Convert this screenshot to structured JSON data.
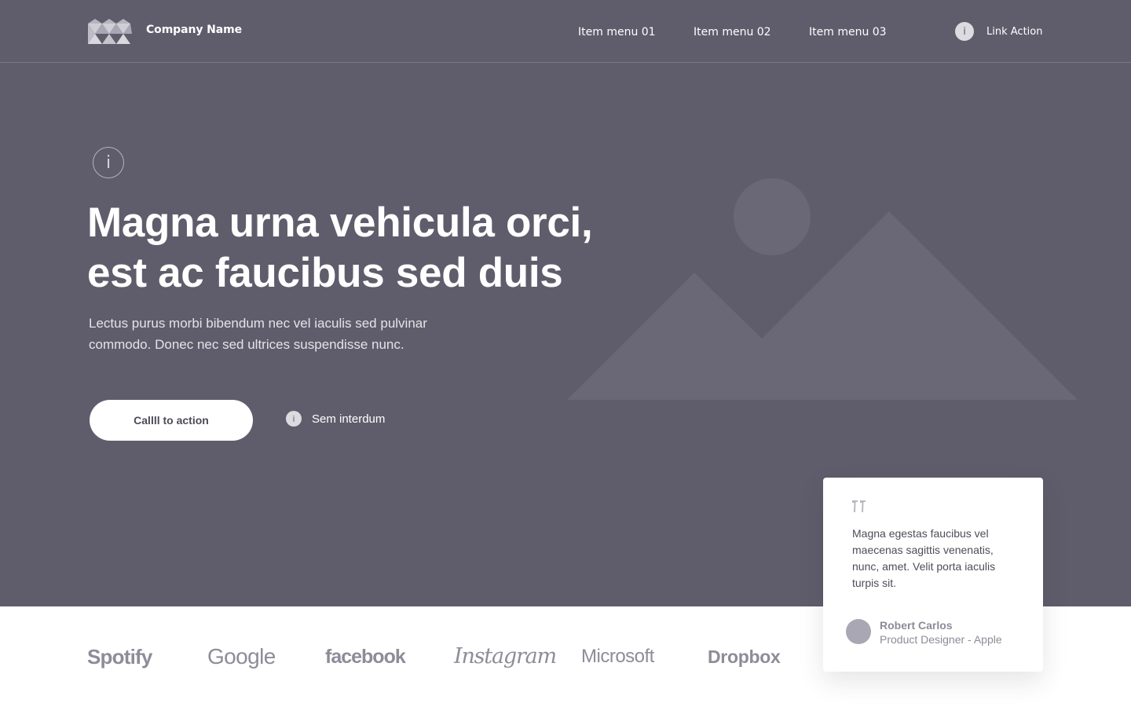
{
  "header": {
    "company_name": "Company Name",
    "nav": [
      "Item menu 01",
      "Item menu 02",
      "Item menu 03"
    ],
    "link_action": "Link Action",
    "info_icon_glyph": "i"
  },
  "hero": {
    "icon_glyph": "i",
    "title_lines": [
      "Magna urna vehicula orci,",
      "est ac faucibus sed duis"
    ],
    "subtitle_lines": [
      "Lectus purus morbi bibendum nec vel iaculis sed pulvinar",
      "commodo. Donec nec sed ultrices suspendisse nunc."
    ],
    "cta_label": "Callll to action",
    "secondary_label": "Sem interdum",
    "secondary_icon_glyph": "i"
  },
  "testimonial": {
    "quote_lines": [
      "Magna egestas faucibus vel",
      "maecenas sagittis venenatis,",
      "nunc, amet. Velit porta iaculis",
      "turpis sit."
    ],
    "author_name": "Robert Carlos",
    "author_role": "Product Designer - Apple"
  },
  "brands": [
    "Spotify",
    "Google",
    "facebook",
    "Instagram",
    "Microsoft",
    "Dropbox"
  ],
  "colors": {
    "hero_background": "#5f5d6b",
    "placeholder_shape": "#6a6876",
    "text_on_dark": "#ffffff",
    "brand_logo_gray": "#8e8c98",
    "card_background": "#ffffff"
  },
  "icons": {
    "logo": "triangle-mosaic-logo",
    "info": "info-circle-icon",
    "hero_image": "image-placeholder-icon",
    "quote": "quote-icon"
  }
}
